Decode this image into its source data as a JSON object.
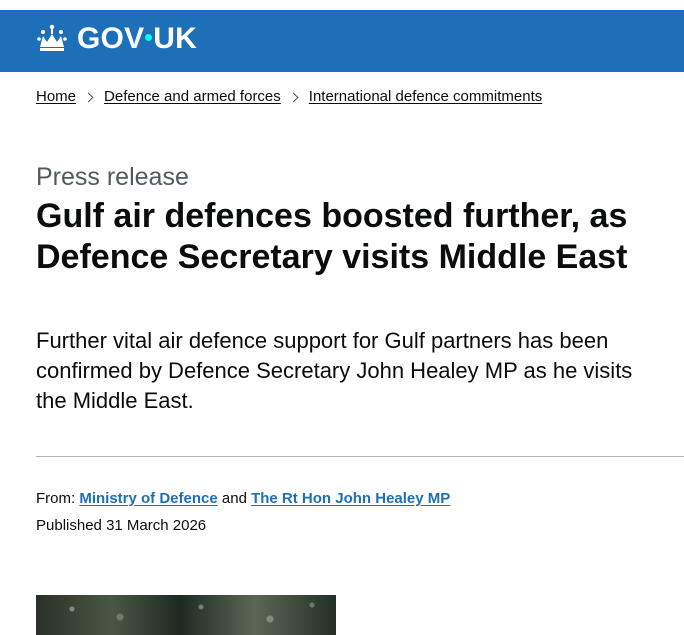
{
  "header": {
    "logo_gov": "GOV",
    "logo_uk": "UK",
    "brand_color": "#1d70b8"
  },
  "breadcrumbs": [
    {
      "label": "Home"
    },
    {
      "label": "Defence and armed forces"
    },
    {
      "label": "International defence commitments"
    }
  ],
  "article": {
    "caption": "Press release",
    "title": "Gulf air defences boosted further, as Defence Secretary visits Middle East",
    "lead": "Further vital air defence support for Gulf partners has been confirmed by Defence Secretary John Healey MP as he visits the Middle East."
  },
  "metadata": {
    "from_label": "From:",
    "from_org": "Ministry of Defence",
    "and_text": "and",
    "from_person": "The Rt Hon John Healey MP",
    "published_label": "Published",
    "published_date": "31 March 2026"
  },
  "icons": {
    "crown": "crown-icon",
    "breadcrumb_separator": "chevron-right-icon"
  }
}
